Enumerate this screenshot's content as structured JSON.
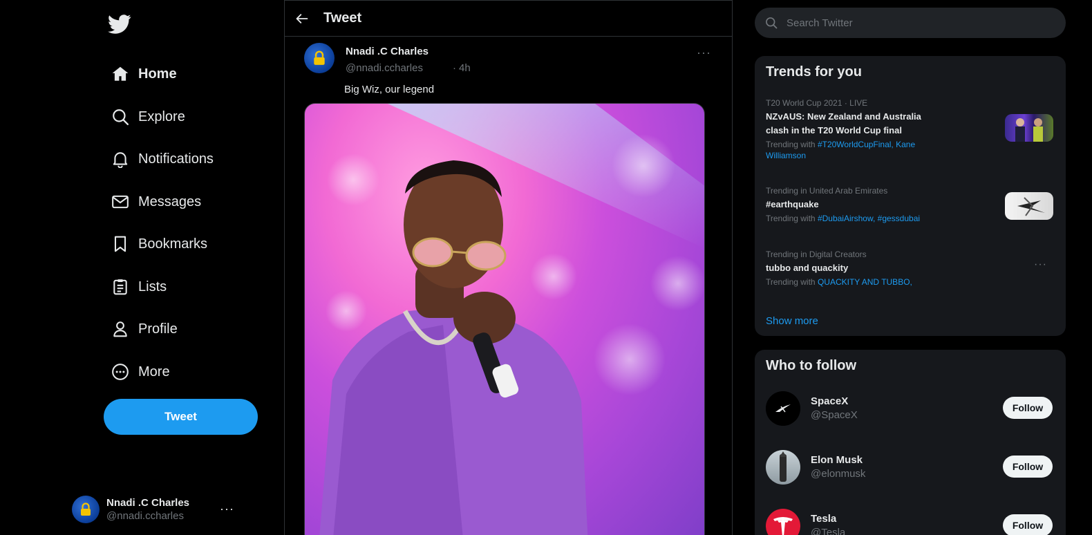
{
  "nav": {
    "items": [
      {
        "label": "Home",
        "icon": "home-icon"
      },
      {
        "label": "Explore",
        "icon": "search-icon"
      },
      {
        "label": "Notifications",
        "icon": "bell-icon"
      },
      {
        "label": "Messages",
        "icon": "envelope-icon"
      },
      {
        "label": "Bookmarks",
        "icon": "bookmark-icon"
      },
      {
        "label": "Lists",
        "icon": "list-icon"
      },
      {
        "label": "Profile",
        "icon": "person-icon"
      },
      {
        "label": "More",
        "icon": "more-circle-icon"
      }
    ],
    "tweet_button": "Tweet"
  },
  "account": {
    "name": "Nnadi .C Charles",
    "handle": "@nnadi.ccharles",
    "more": "···"
  },
  "main": {
    "title": "Tweet",
    "tweet": {
      "author_name": "Nnadi .C Charles",
      "author_handle": "@nnadi.ccharles",
      "separator": "·",
      "time": "4h",
      "more": "···",
      "text": "Big Wiz, our legend"
    }
  },
  "search": {
    "placeholder": "Search Twitter"
  },
  "trends": {
    "title": "Trends for you",
    "items": [
      {
        "meta": "T20 World Cup 2021 · LIVE",
        "title": "NZvAUS: New Zealand and Australia clash in the T20 World Cup final",
        "with_prefix": "Trending with ",
        "with_links": "#T20WorldCupFinal, Kane Williamson"
      },
      {
        "meta": "Trending in United Arab Emirates",
        "title": "#earthquake",
        "with_prefix": "Trending with ",
        "with_links": "#DubaiAirshow, #gessdubai"
      },
      {
        "meta": "Trending in Digital Creators",
        "title": "tubbo and quackity",
        "with_prefix": "Trending with ",
        "with_links": "QUACKITY AND TUBBO,",
        "more": "···"
      }
    ],
    "show_more": "Show more"
  },
  "who_to_follow": {
    "title": "Who to follow",
    "items": [
      {
        "name": "SpaceX",
        "handle": "@SpaceX",
        "button": "Follow"
      },
      {
        "name": "Elon Musk",
        "handle": "@elonmusk",
        "button": "Follow"
      },
      {
        "name": "Tesla",
        "handle": "@Tesla",
        "button": "Follow"
      }
    ]
  },
  "colors": {
    "background": "#000000",
    "accent": "#1d9bf0",
    "panel": "#16181c",
    "muted_text": "#71767b",
    "primary_text": "#e7e9ea"
  }
}
